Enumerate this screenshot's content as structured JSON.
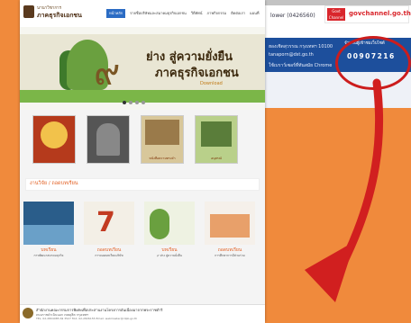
{
  "colors": {
    "background": "#f08a3c",
    "accent_orange": "#e25f22",
    "nav_blue": "#2b6cc4",
    "annotation_red": "#cc1d1d"
  },
  "background_site": {
    "header_text": "lower (0426560)",
    "logo_box": "Govt Channel",
    "logo_text": "govchannel.go.th",
    "nav_line1": "ฮองเชิดสุวรรณ กรุงเทพฯ 10100",
    "nav_line2": "tanaporn@dst.go.th",
    "nav_line3": "ใช้เบราว์เซอร์ที่ทันสมัย Chrome",
    "counter_label": "จำนวนผู้เข้าชมเว็บไซต์",
    "counter_value": "00907216"
  },
  "site": {
    "logo_line1": "นานาวิชาการ",
    "logo_line2": "ภาคธุรกิจเอกชน",
    "nav": [
      "หน้าหลัก",
      "รายชื่อบริษัทและสมาคมธุรกิจเอกชน",
      "วีดีทัศน์",
      "ภาพกิจกรรม",
      "ติดต่อเรา",
      "แผนที่"
    ],
    "hero": {
      "numeral": "๙",
      "line1": "ย่าง สู่ความยั่งยืน",
      "line2": "ภาคธุรกิจเอกชน",
      "download": "Download"
    },
    "thumb_captions": [
      "",
      "",
      "หนังสือความทรงจำ",
      "อนุสรณ์"
    ],
    "section_title": "งานวิจัย / ถอดบทเรียน",
    "books": [
      {
        "tag": "บทเรียน",
        "desc": "การพัฒนาสมาคมธุรกิจ"
      },
      {
        "tag": "ถอดบทเรียน",
        "desc": "การถอดบทเรียนบริษัท"
      },
      {
        "tag": "บทเรียน",
        "desc": "๙ ย่าง สู่ความยั่งยืน"
      },
      {
        "tag": "ถอดบทเรียน",
        "desc": "การศึกษาการมีส่วนร่วม"
      }
    ],
    "footer": {
      "line1": "สำนักงานคณะกรรมการพิเศษเพื่อประสานงานโครงการอันเนื่องมาจากพระราชดำริ",
      "line2": "ถนนราชดำเนินนอก เขตดุสิต กรุงเทพฯ",
      "line3": "TEL. 02-2804085 ต่อ 3527 FAX. 02-2826155 Email: webmaster@rdpb.go.th"
    }
  }
}
